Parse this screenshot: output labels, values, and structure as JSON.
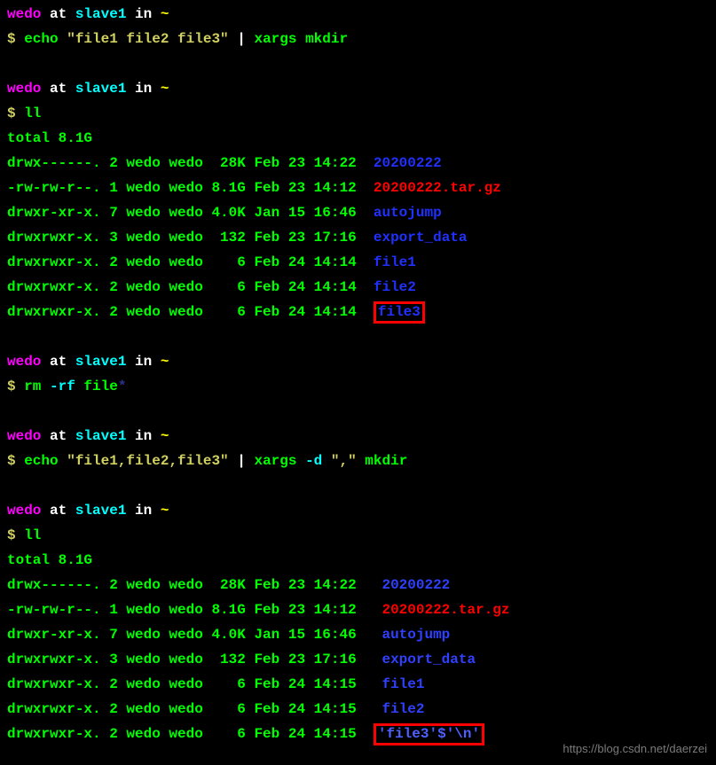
{
  "prompt": {
    "user": "wedo",
    "at": " at ",
    "host": "slave1",
    "in_": " in ",
    "path": "~",
    "symbol": "$ "
  },
  "commands": {
    "echo1_cmd": "echo ",
    "echo1_str": "\"file1 file2 file3\"",
    "pipe": " | ",
    "xargs1": "xargs ",
    "mkdir": "mkdir",
    "ll": "ll",
    "rm_cmd": "rm ",
    "rm_flag": "-rf ",
    "rm_arg": "file",
    "rm_glob": "*",
    "echo2_cmd": "echo ",
    "echo2_str": "\"file1,file2,file3\"",
    "xargs2": "xargs ",
    "xargs2_flag": "-d ",
    "xargs2_arg": "\",\"",
    "mkdir2": " mkdir"
  },
  "listing1": {
    "total": "total 8.1G",
    "rows": [
      {
        "perm": "drwx------.",
        "n": "2",
        "u": "wedo",
        "g": "wedo",
        "size": " 28K",
        "date": "Feb 23 14:22",
        "name": "20200222",
        "cls": "dir-blue"
      },
      {
        "perm": "-rw-rw-r--.",
        "n": "1",
        "u": "wedo",
        "g": "wedo",
        "size": "8.1G",
        "date": "Feb 23 14:12",
        "name": "20200222.tar.gz",
        "cls": "tar-red"
      },
      {
        "perm": "drwxr-xr-x.",
        "n": "7",
        "u": "wedo",
        "g": "wedo",
        "size": "4.0K",
        "date": "Jan 15 16:46",
        "name": "autojump",
        "cls": "dir-blue"
      },
      {
        "perm": "drwxrwxr-x.",
        "n": "3",
        "u": "wedo",
        "g": "wedo",
        "size": " 132",
        "date": "Feb 23 17:16",
        "name": "export_data",
        "cls": "dir-blue"
      },
      {
        "perm": "drwxrwxr-x.",
        "n": "2",
        "u": "wedo",
        "g": "wedo",
        "size": "   6",
        "date": "Feb 24 14:14",
        "name": "file1",
        "cls": "dir-blue"
      },
      {
        "perm": "drwxrwxr-x.",
        "n": "2",
        "u": "wedo",
        "g": "wedo",
        "size": "   6",
        "date": "Feb 24 14:14",
        "name": "file2",
        "cls": "dir-blue"
      },
      {
        "perm": "drwxrwxr-x.",
        "n": "2",
        "u": "wedo",
        "g": "wedo",
        "size": "   6",
        "date": "Feb 24 14:14",
        "name": "file3",
        "cls": "dir-blue",
        "box": true
      }
    ]
  },
  "listing2": {
    "total": "total 8.1G",
    "rows": [
      {
        "perm": "drwx------.",
        "n": "2",
        "u": "wedo",
        "g": "wedo",
        "size": " 28K",
        "date": "Feb 23 14:22",
        "name": "20200222",
        "cls": "dir-blue2",
        "pad": "  "
      },
      {
        "perm": "-rw-rw-r--.",
        "n": "1",
        "u": "wedo",
        "g": "wedo",
        "size": "8.1G",
        "date": "Feb 23 14:12",
        "name": "20200222.tar.gz",
        "cls": "tar-red",
        "pad": "  "
      },
      {
        "perm": "drwxr-xr-x.",
        "n": "7",
        "u": "wedo",
        "g": "wedo",
        "size": "4.0K",
        "date": "Jan 15 16:46",
        "name": "autojump",
        "cls": "dir-blue2",
        "pad": "  "
      },
      {
        "perm": "drwxrwxr-x.",
        "n": "3",
        "u": "wedo",
        "g": "wedo",
        "size": " 132",
        "date": "Feb 23 17:16",
        "name": "export_data",
        "cls": "dir-blue2",
        "pad": "  "
      },
      {
        "perm": "drwxrwxr-x.",
        "n": "2",
        "u": "wedo",
        "g": "wedo",
        "size": "   6",
        "date": "Feb 24 14:15",
        "name": "file1",
        "cls": "dir-blue2",
        "pad": "  "
      },
      {
        "perm": "drwxrwxr-x.",
        "n": "2",
        "u": "wedo",
        "g": "wedo",
        "size": "   6",
        "date": "Feb 24 14:15",
        "name": "file2",
        "cls": "dir-blue2",
        "pad": "  "
      },
      {
        "perm": "drwxrwxr-x.",
        "n": "2",
        "u": "wedo",
        "g": "wedo",
        "size": "   6",
        "date": "Feb 24 14:15",
        "name": "'file3'$'\\n'",
        "cls": "quoted",
        "pad": " ",
        "box": true
      }
    ]
  },
  "watermark": "https://blog.csdn.net/daerzei"
}
